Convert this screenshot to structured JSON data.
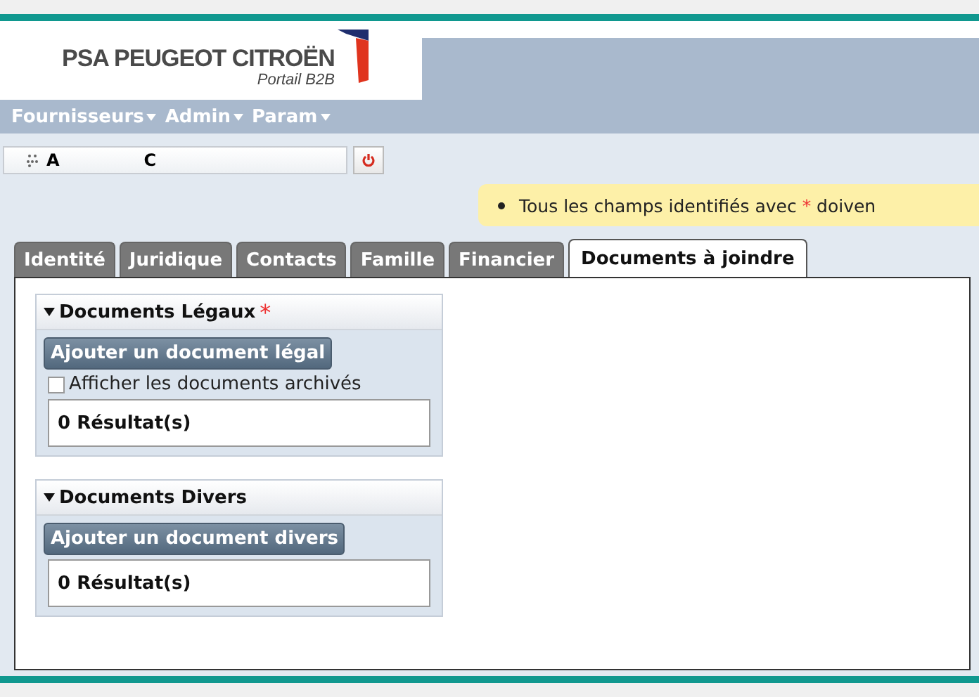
{
  "logo": {
    "brand": "PSA PEUGEOT CITROËN",
    "subtitle": "Portail B2B"
  },
  "menu": [
    {
      "label": "Fournisseurs"
    },
    {
      "label": "Admin"
    },
    {
      "label": "Param"
    }
  ],
  "user": {
    "initials": [
      "A",
      "C"
    ]
  },
  "notice": {
    "before": "Tous les champs identifiés avec ",
    "mark": "*",
    "after": " doiven"
  },
  "tabs": [
    {
      "label": "Identité",
      "selected": false
    },
    {
      "label": "Juridique",
      "selected": false
    },
    {
      "label": "Contacts",
      "selected": false
    },
    {
      "label": "Famille",
      "selected": false
    },
    {
      "label": "Financier",
      "selected": false
    },
    {
      "label": "Documents à joindre",
      "selected": true
    }
  ],
  "sections": [
    {
      "title": "Documents Légaux",
      "required": true,
      "expanded": true,
      "button": "Ajouter un document légal",
      "checkbox": {
        "label": "Afficher les documents archivés",
        "checked": false
      },
      "results": "0 Résultat(s)"
    },
    {
      "title": "Documents Divers",
      "required": false,
      "expanded": true,
      "button": "Ajouter un document divers",
      "results": "0 Résultat(s)"
    }
  ]
}
